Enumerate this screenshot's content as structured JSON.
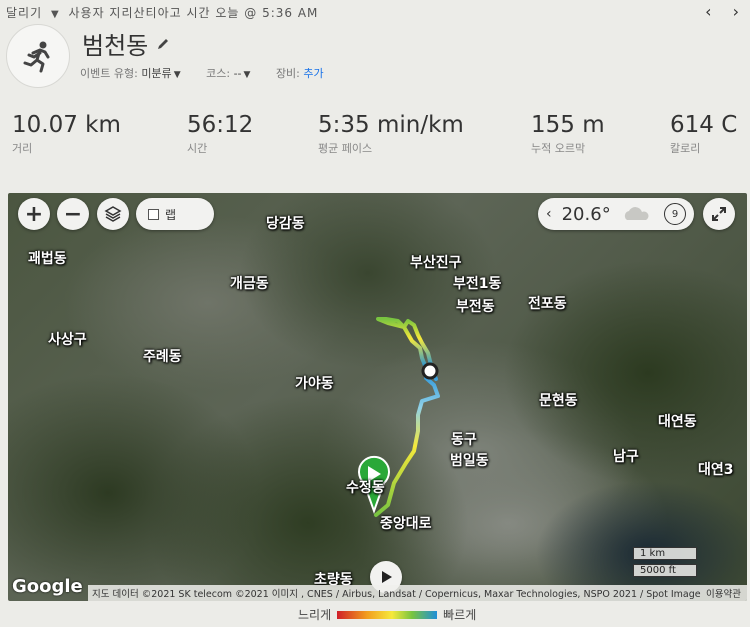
{
  "topbar": {
    "activity_type": "달리기",
    "caret": "▼",
    "owner_text": "사용자 지리산티아고 시간 오늘 @ 5:36 AM"
  },
  "nav": {
    "prev": "‹",
    "next": "›"
  },
  "activity": {
    "title": "범천동",
    "avatar_icon": "running-person-icon",
    "event_type_label": "이벤트 유형:",
    "event_type_value": "미분류",
    "course_label": "코스:",
    "course_value": "--",
    "gear_label": "장비:",
    "gear_value": "추가"
  },
  "stats": [
    {
      "value": "10.07 km",
      "label": "거리"
    },
    {
      "value": "56:12",
      "label": "시간"
    },
    {
      "value": "5:35 min/km",
      "label": "평균 페이스"
    },
    {
      "value": "155 m",
      "label": "누적 오르막"
    },
    {
      "value": "614 C",
      "label": "칼로리"
    }
  ],
  "map": {
    "zoom_in": "+",
    "zoom_out": "−",
    "lap_label": "랩",
    "weather_temp": "20.6°",
    "wind_speed": "9",
    "google_logo": "Google",
    "attribution": "지도 데이터 ©2021 SK telecom ©2021 이미지 , CNES / Airbus, Landsat / Copernicus, Maxar Technologies, NSPO 2021 / Spot Image",
    "terms": "이용약관",
    "scale_km": "1 km",
    "scale_ft": "5000 ft",
    "places": [
      {
        "name": "당감동"
      },
      {
        "name": "괘법동"
      },
      {
        "name": "부산진구"
      },
      {
        "name": "부전1동"
      },
      {
        "name": "개금동"
      },
      {
        "name": "부전동"
      },
      {
        "name": "전포동"
      },
      {
        "name": "사상구"
      },
      {
        "name": "주례동"
      },
      {
        "name": "가야동"
      },
      {
        "name": "문현동"
      },
      {
        "name": "대연동"
      },
      {
        "name": "동구"
      },
      {
        "name": "범일동"
      },
      {
        "name": "남구"
      },
      {
        "name": "대연3"
      },
      {
        "name": "수정동"
      },
      {
        "name": "중앙대로"
      },
      {
        "name": "초량동"
      }
    ]
  },
  "legend": {
    "slow": "느리게",
    "fast": "빠르게"
  },
  "colors": {
    "route_slow": "#d0202a",
    "route_mid": "#f6e93b",
    "route_fast": "#1f8fd8",
    "link": "#1a73e8"
  }
}
